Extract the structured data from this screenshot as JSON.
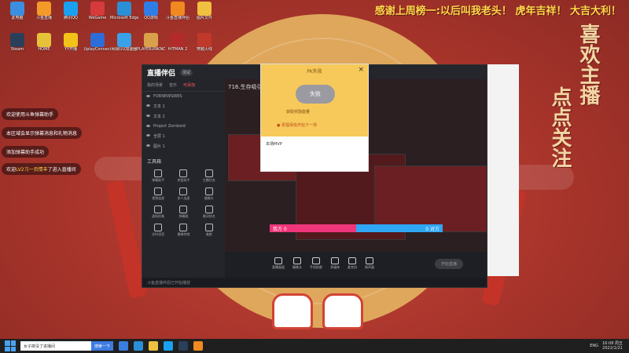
{
  "wallpaper": {
    "banner": "感谢上周榜一:以后叫我老头！ 虎年吉祥！ 大吉大利！",
    "calligraphy_1": "喜欢主播",
    "calligraphy_2": "点点关注"
  },
  "desktop_icons": [
    {
      "label": "此电脑",
      "color": "#3c8fe0"
    },
    {
      "label": "斗鱼直播",
      "color": "#f39a28"
    },
    {
      "label": "腾讯QQ",
      "color": "#1aa0f0"
    },
    {
      "label": "WeGame",
      "color": "#d63a3a"
    },
    {
      "label": "Microsoft Edge",
      "color": "#2b8fd6"
    },
    {
      "label": "QQ游戏",
      "color": "#2f7ee8"
    },
    {
      "label": "斗鱼直播伴侣",
      "color": "#f08a20"
    },
    {
      "label": "图片文件",
      "color": "#f0c040"
    },
    {
      "label": "Steam",
      "color": "#2a3f5a"
    },
    {
      "label": "HOME",
      "color": "#e6c23a"
    },
    {
      "label": "YY开播",
      "color": "#f2c218"
    },
    {
      "label": "UplayConnect",
      "color": "#2d6dd8"
    },
    {
      "label": "网易UU加速器",
      "color": "#3aa0e8"
    },
    {
      "label": "PLAYERUNKNOWN'S BATTLEGROUNDS",
      "color": "#d9a24a"
    },
    {
      "label": "HITMAN 2",
      "color": "#b32a2a"
    },
    {
      "label": "穿越火线",
      "color": "#c0392b"
    }
  ],
  "notifications": [
    {
      "text": "欢迎使用斗鱼弹幕助手"
    },
    {
      "text": "本区域会显示弹幕消息和礼物消息"
    },
    {
      "text": "添加弹幕助手成功"
    },
    {
      "text_pre": "欢迎",
      "highlight": "LV2习一页情丰",
      "text_post": "了进入直播间"
    }
  ],
  "app": {
    "logo": "直播伴侣",
    "badge": "测试",
    "tabs": [
      "我的场景",
      "音乐",
      "可添加"
    ],
    "active_tab": "可添加",
    "scenes": [
      "FORNEWSIRES",
      "文本 1",
      "文本 2",
      "Project Zomboid",
      "全屏 1",
      "图片 1"
    ],
    "tools_title": "工具箱",
    "tools": [
      "弹幕助手",
      "房管助手",
      "主播任务",
      "视频连麦",
      "多人连麦",
      "摄像头",
      "虚拟形象",
      "弹幕姬",
      "歌词排名",
      "实时语音",
      "摄像特效",
      "美颜"
    ],
    "preview_title": "716.生存吸引",
    "status": "斗鱼直播伴侣已开始播放",
    "controls": [
      "直播画面",
      "摄像头",
      "手机投屏",
      "多媒体",
      "麦克风",
      "扬声器"
    ],
    "start_button": "开始直播"
  },
  "pk_popup": {
    "title": "PK失败",
    "result": "失败",
    "reward": "获取奖励能量",
    "next": "● 祝福保佑开始下一场",
    "mvp": "本场MVP"
  },
  "pk_bar": {
    "left_label": "我方 0",
    "right_label": "0 对方"
  },
  "taskbar": {
    "search_placeholder": "女子摔没了进播间",
    "search_button": "搜索一下",
    "time": "16:08 周五",
    "date": "2022/1/21",
    "lang": "ENG"
  }
}
